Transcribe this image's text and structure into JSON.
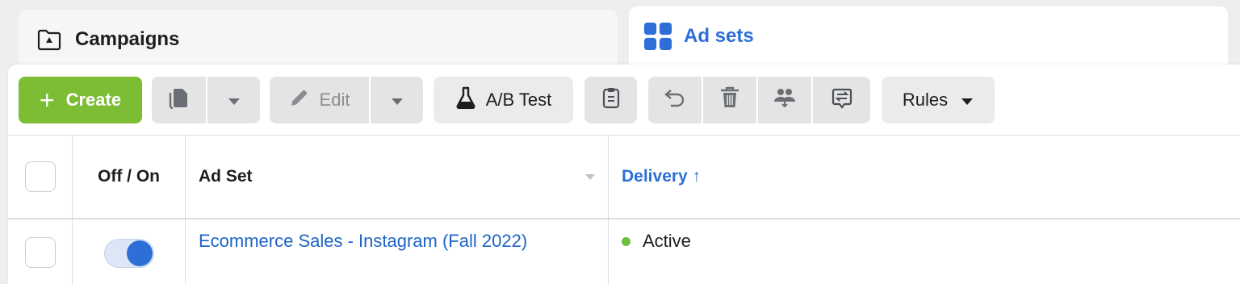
{
  "tabs": {
    "campaigns": {
      "label": "Campaigns",
      "icon": "folder-icon"
    },
    "adsets": {
      "label": "Ad sets",
      "icon": "grid-icon"
    }
  },
  "toolbar": {
    "create_label": "Create",
    "edit_label": "Edit",
    "ab_test_label": "A/B Test",
    "rules_label": "Rules",
    "accent": "#7cbd34"
  },
  "table": {
    "headers": {
      "toggle": "Off / On",
      "name": "Ad Set",
      "delivery": "Delivery ↑"
    },
    "rows": [
      {
        "name": "Ecommerce Sales - Instagram (Fall 2022)",
        "on": true,
        "delivery": "Active"
      }
    ]
  }
}
